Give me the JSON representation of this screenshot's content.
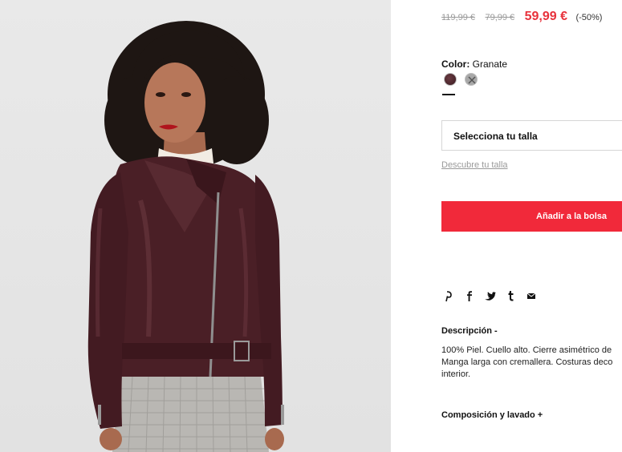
{
  "product": {
    "image_alt": "Chaqueta biker de piel granate",
    "prices": {
      "original": "119,99 €",
      "previous": "79,99 €",
      "current": "59,99 €",
      "discount": "(-50%)"
    },
    "color": {
      "label": "Color:",
      "value": "Granate",
      "swatches": [
        {
          "name": "Granate",
          "hex": "#4a252b",
          "selected": true
        },
        {
          "name": "Gris",
          "hex": "#a8a8a8",
          "selected": false,
          "unavailable": true
        }
      ]
    },
    "size_select": {
      "label": "Selecciona tu talla"
    },
    "size_guide": "Descubre tu talla",
    "add_to_bag": "Añadir a la bolsa",
    "share_icons": [
      "pinterest-icon",
      "facebook-icon",
      "twitter-icon",
      "tumblr-icon",
      "email-icon"
    ],
    "description": {
      "title": "Descripción -",
      "lines": [
        "100% Piel. Cuello alto. Cierre asimétrico de",
        "Manga larga con cremallera. Costuras deco",
        "interior."
      ]
    },
    "composition": {
      "title": "Composición y lavado +"
    }
  },
  "colors": {
    "accent": "#f1293a",
    "sale_price": "#e8323c",
    "muted": "#9a9a9a"
  }
}
